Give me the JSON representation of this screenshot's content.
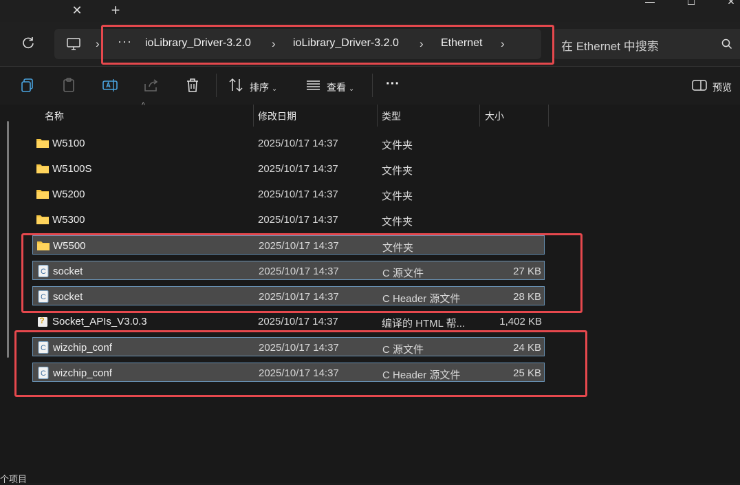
{
  "window": {
    "close_tab_glyph": "✕",
    "new_tab_glyph": "+",
    "minimize_glyph": "—",
    "maximize_glyph": "☐",
    "close_glyph": "✕"
  },
  "nav": {
    "more": "···",
    "separator": "›",
    "crumbs": [
      "ioLibrary_Driver-3.2.0",
      "ioLibrary_Driver-3.2.0",
      "Ethernet"
    ],
    "search_placeholder": "在 Ethernet 中搜索"
  },
  "toolbar": {
    "sort_label": "排序",
    "view_label": "查看",
    "more": "···",
    "preview_label": "预览"
  },
  "columns": {
    "name": "名称",
    "date": "修改日期",
    "type": "类型",
    "size": "大小"
  },
  "files": [
    {
      "name": "W5100",
      "date": "2025/10/17 14:37",
      "type": "文件夹",
      "size": "",
      "icon": "folder-icon",
      "selected": false
    },
    {
      "name": "W5100S",
      "date": "2025/10/17 14:37",
      "type": "文件夹",
      "size": "",
      "icon": "folder-icon",
      "selected": false
    },
    {
      "name": "W5200",
      "date": "2025/10/17 14:37",
      "type": "文件夹",
      "size": "",
      "icon": "folder-icon",
      "selected": false
    },
    {
      "name": "W5300",
      "date": "2025/10/17 14:37",
      "type": "文件夹",
      "size": "",
      "icon": "folder-icon",
      "selected": false
    },
    {
      "name": "W5500",
      "date": "2025/10/17 14:37",
      "type": "文件夹",
      "size": "",
      "icon": "folder-icon",
      "selected": true
    },
    {
      "name": "socket",
      "date": "2025/10/17 14:37",
      "type": "C 源文件",
      "size": "27 KB",
      "icon": "c-source-file-icon",
      "selected": true
    },
    {
      "name": "socket",
      "date": "2025/10/17 14:37",
      "type": "C Header 源文件",
      "size": "28 KB",
      "icon": "c-header-file-icon",
      "selected": true
    },
    {
      "name": "Socket_APIs_V3.0.3",
      "date": "2025/10/17 14:37",
      "type": "编译的 HTML 帮...",
      "size": "1,402 KB",
      "icon": "help-file-icon",
      "selected": false
    },
    {
      "name": "wizchip_conf",
      "date": "2025/10/17 14:37",
      "type": "C 源文件",
      "size": "24 KB",
      "icon": "c-source-file-icon",
      "selected": true
    },
    {
      "name": "wizchip_conf",
      "date": "2025/10/17 14:37",
      "type": "C Header 源文件",
      "size": "25 KB",
      "icon": "c-header-file-icon",
      "selected": true
    }
  ],
  "status": {
    "items_text": "个项目"
  },
  "colors": {
    "highlight": "#e5484d",
    "selection_border": "#6a93b5",
    "folder": "#f5c542"
  }
}
